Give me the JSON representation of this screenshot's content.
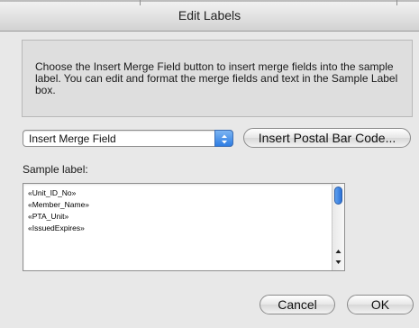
{
  "window": {
    "title": "Edit Labels"
  },
  "info": {
    "text": "Choose the Insert Merge Field button to insert merge fields into the sample label.  You can edit and format the merge fields and text in the Sample Label box."
  },
  "merge_field_select": {
    "value": "Insert Merge Field"
  },
  "buttons": {
    "insert_postal_bar_code": "Insert Postal Bar Code...",
    "cancel": "Cancel",
    "ok": "OK"
  },
  "sample_label": {
    "label": "Sample label:",
    "lines": [
      "«Unit_ID_No»",
      "«Member_Name»",
      "«PTA_Unit»",
      "«IssuedExpires»"
    ]
  },
  "icons": {
    "select_arrows": "up-down-chevron-icon",
    "scroll_up": "scroll-up-arrow-icon",
    "scroll_down": "scroll-down-arrow-icon"
  },
  "colors": {
    "accent": "#2e7de3"
  }
}
